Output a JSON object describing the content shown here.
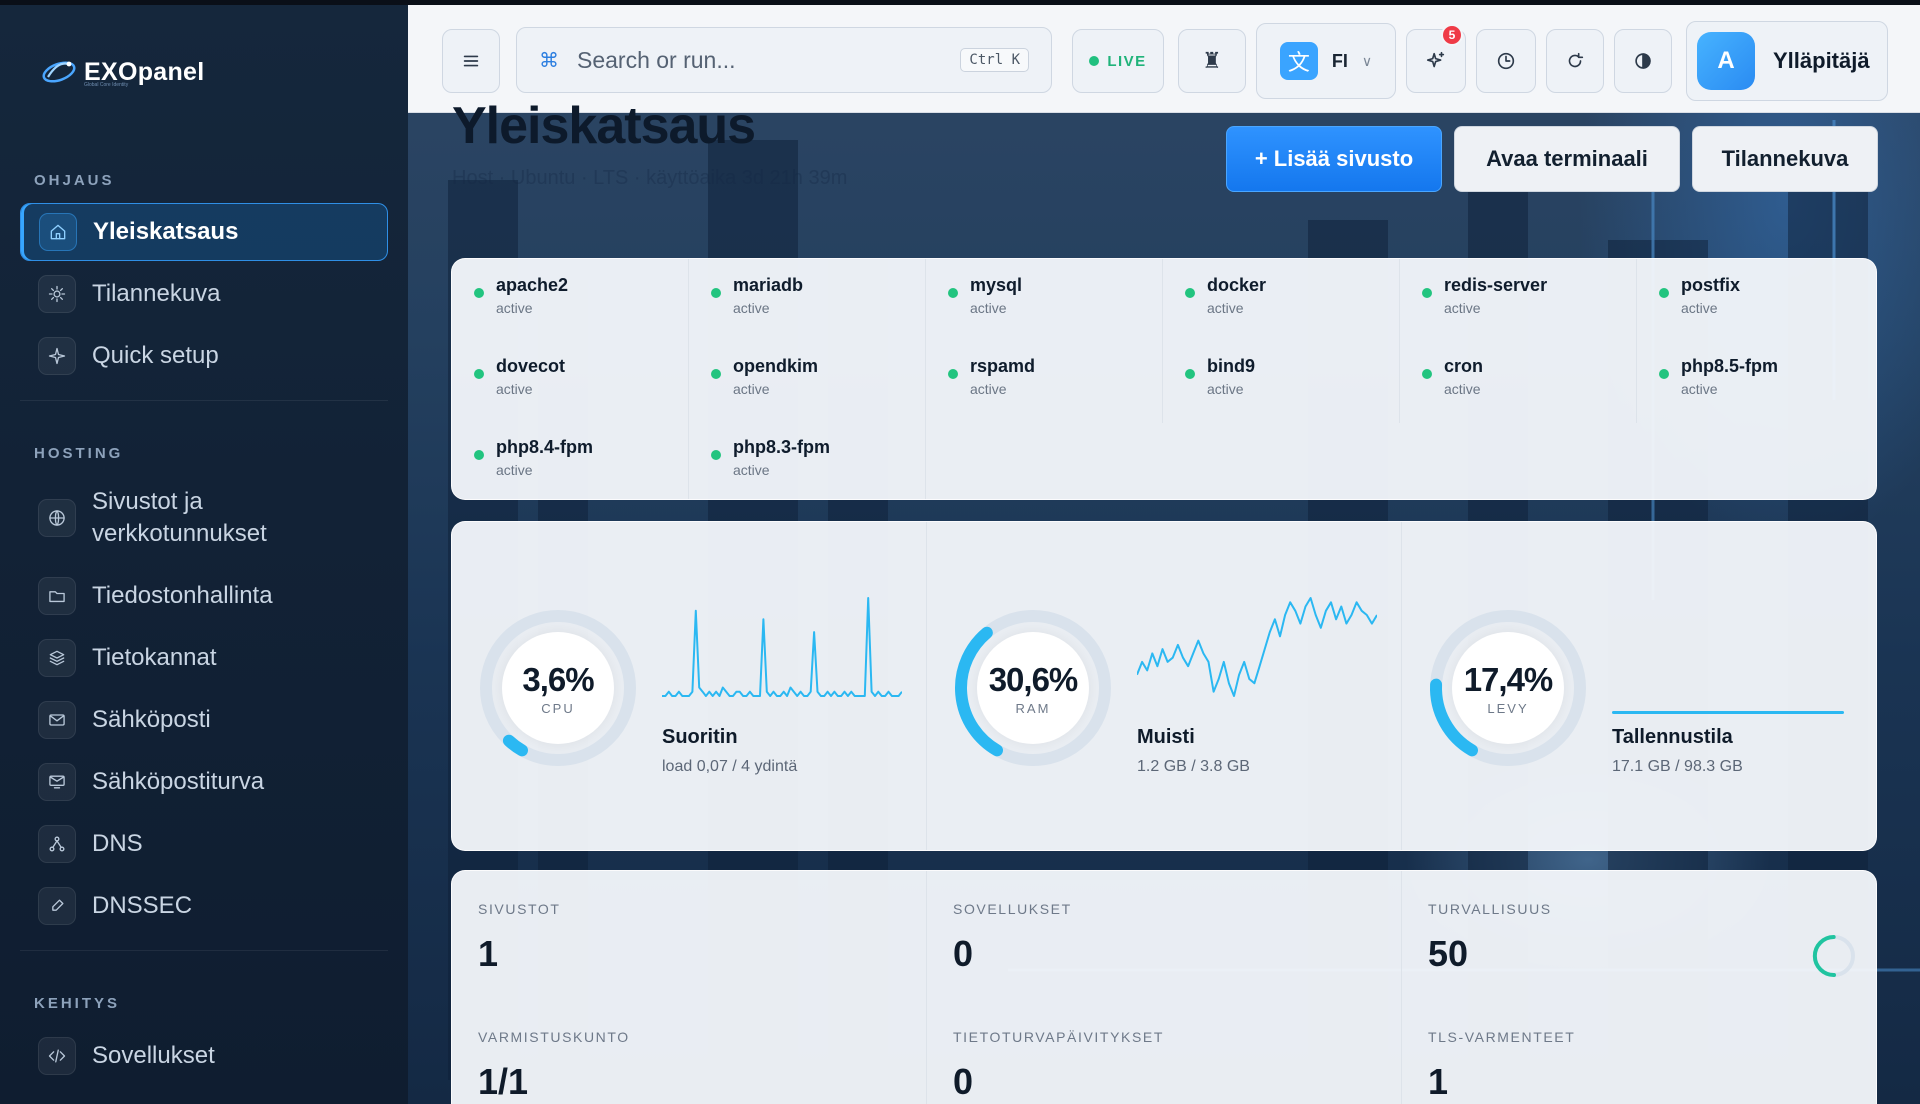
{
  "brand": {
    "name": "EXOpanel",
    "tagline": "Global Core Identity"
  },
  "sidebar": {
    "sections": [
      {
        "label": "OHJAUS"
      },
      {
        "label": "HOSTING"
      },
      {
        "label": "KEHITYS"
      }
    ],
    "items": [
      {
        "label": "Yleiskatsaus",
        "icon": "home-icon",
        "active": true
      },
      {
        "label": "Tilannekuva",
        "icon": "sun-icon"
      },
      {
        "label": "Quick setup",
        "icon": "sparkle-icon"
      },
      {
        "label": "Sivustot ja\nverkkotunnukset",
        "icon": "globe-icon"
      },
      {
        "label": "Tiedostonhallinta",
        "icon": "folder-icon"
      },
      {
        "label": "Tietokannat",
        "icon": "layers-icon"
      },
      {
        "label": "Sähköposti",
        "icon": "mail-icon"
      },
      {
        "label": "Sähköpostiturva",
        "icon": "mail-shield-icon"
      },
      {
        "label": "DNS",
        "icon": "network-icon"
      },
      {
        "label": "DNSSEC",
        "icon": "key-icon"
      },
      {
        "label": "Sovellukset",
        "icon": "code-icon"
      }
    ]
  },
  "topbar": {
    "search_placeholder": "Search or run...",
    "search_shortcut": "Ctrl K",
    "live_label": "LIVE",
    "language": "FI",
    "language_glyph": "文",
    "notifications_count": "5",
    "user_initial": "A",
    "user_name": "Ylläpitäjä"
  },
  "page": {
    "title": "Yleiskatsaus",
    "subtitle": "Host · Ubuntu · LTS · käyttöaika 3d 21h 39m",
    "actions": {
      "add_site": "+ Lisää sivusto",
      "open_terminal": "Avaa terminaali",
      "snapshot": "Tilannekuva"
    }
  },
  "services": [
    {
      "name": "apache2",
      "status": "active"
    },
    {
      "name": "mariadb",
      "status": "active"
    },
    {
      "name": "mysql",
      "status": "active"
    },
    {
      "name": "docker",
      "status": "active"
    },
    {
      "name": "redis-server",
      "status": "active"
    },
    {
      "name": "postfix",
      "status": "active"
    },
    {
      "name": "dovecot",
      "status": "active"
    },
    {
      "name": "opendkim",
      "status": "active"
    },
    {
      "name": "rspamd",
      "status": "active"
    },
    {
      "name": "bind9",
      "status": "active"
    },
    {
      "name": "cron",
      "status": "active"
    },
    {
      "name": "php8.5-fpm",
      "status": "active"
    },
    {
      "name": "php8.4-fpm",
      "status": "active"
    },
    {
      "name": "php8.3-fpm",
      "status": "active"
    }
  ],
  "metrics": [
    {
      "gauge_value": "3,6%",
      "percent": 3.6,
      "gauge_label": "CPU",
      "name": "Suoritin",
      "detail": "load 0,07 / 4 ydintä",
      "history": [
        2,
        2,
        3,
        2,
        2,
        3,
        2,
        2,
        2,
        3,
        22,
        4,
        3,
        2,
        3,
        2,
        3,
        2,
        4,
        3,
        2,
        2,
        3,
        3,
        2,
        2,
        3,
        2,
        2,
        2,
        20,
        3,
        2,
        3,
        2,
        2,
        3,
        2,
        4,
        3,
        2,
        3,
        2,
        2,
        3,
        17,
        3,
        2,
        2,
        3,
        2,
        3,
        2,
        2,
        3,
        2,
        3,
        2,
        2,
        2,
        2,
        25,
        3,
        2,
        3,
        2,
        2,
        3,
        2,
        2,
        2,
        3
      ]
    },
    {
      "gauge_value": "30,6%",
      "percent": 30.6,
      "gauge_label": "RAM",
      "name": "Muisti",
      "detail": "1.2 GB / 3.8 GB",
      "history": [
        29.6,
        29.9,
        29.7,
        30.1,
        29.8,
        30.2,
        29.9,
        30.0,
        30.3,
        30.0,
        29.8,
        30.1,
        30.4,
        30.1,
        29.9,
        29.2,
        29.5,
        29.9,
        29.4,
        29.1,
        29.6,
        29.9,
        29.5,
        29.4,
        29.8,
        30.2,
        30.6,
        30.9,
        30.5,
        31.0,
        31.3,
        31.1,
        30.8,
        31.2,
        31.4,
        31.0,
        30.7,
        31.1,
        31.3,
        30.9,
        31.2,
        30.8,
        31.0,
        31.3,
        31.1,
        31.0,
        30.8,
        31.0
      ]
    },
    {
      "gauge_value": "17,4%",
      "percent": 17.4,
      "gauge_label": "LEVY",
      "name": "Tallennustila",
      "detail": "17.1 GB / 98.3 GB",
      "history": []
    }
  ],
  "stats": [
    {
      "label": "SIVUSTOT",
      "value": "1"
    },
    {
      "label": "SOVELLUKSET",
      "value": "0"
    },
    {
      "label": "TURVALLISUUS",
      "value": "50"
    },
    {
      "label": "VARMISTUSKUNTO",
      "value": "1/1"
    },
    {
      "label": "TIETOTURVAPÄIVITYKSET",
      "value": "0"
    },
    {
      "label": "TLS-VARMENTEET",
      "value": "1"
    }
  ],
  "security_score_percent": 50,
  "colors": {
    "accent": "#2f93ff",
    "active_dot": "#22c47f",
    "gauge": "#2bb8f2",
    "ring_track": "#d9e2ec"
  }
}
